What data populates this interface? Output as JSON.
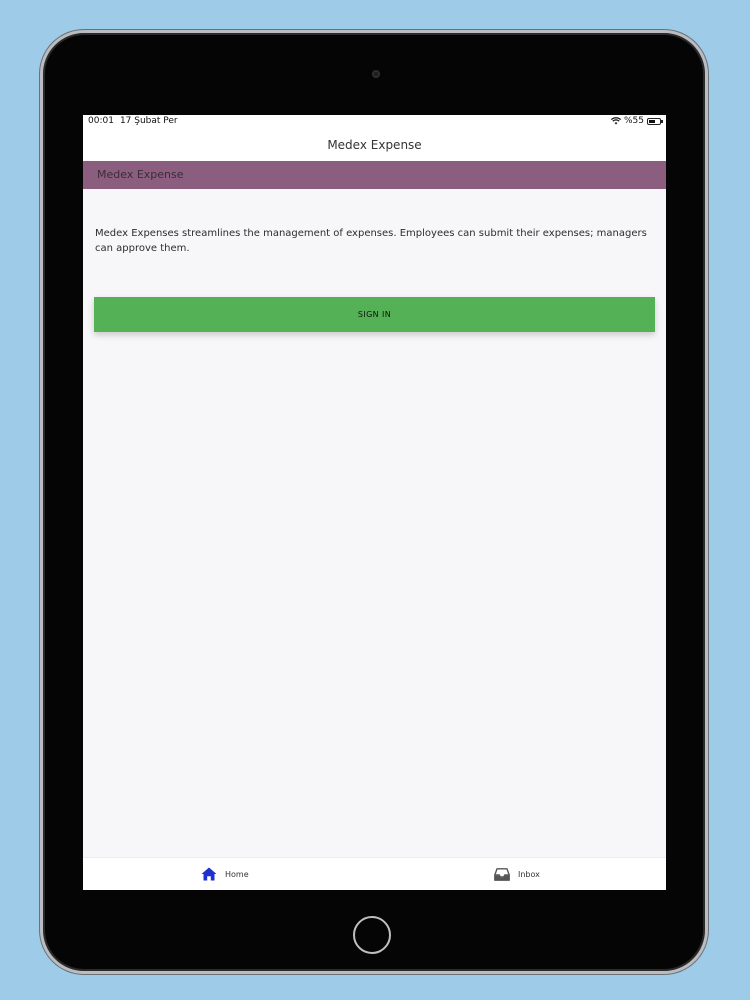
{
  "status_bar": {
    "time": "00:01",
    "date": "17 Şubat Per",
    "battery": "%55"
  },
  "nav": {
    "title": "Medex Expense"
  },
  "header": {
    "title": "Medex Expense"
  },
  "main": {
    "description": "Medex Expenses streamlines the management of expenses. Employees can submit their expenses; managers can approve them.",
    "sign_in_label": "SIGN IN"
  },
  "tabs": [
    {
      "label": "Home",
      "icon": "home-icon",
      "color": "#1f2fd0"
    },
    {
      "label": "Inbox",
      "icon": "inbox-icon",
      "color": "#555555"
    }
  ],
  "colors": {
    "header_banner": "#8b5e7f",
    "sign_in_button": "#55b155",
    "background": "#9ecbe8"
  }
}
